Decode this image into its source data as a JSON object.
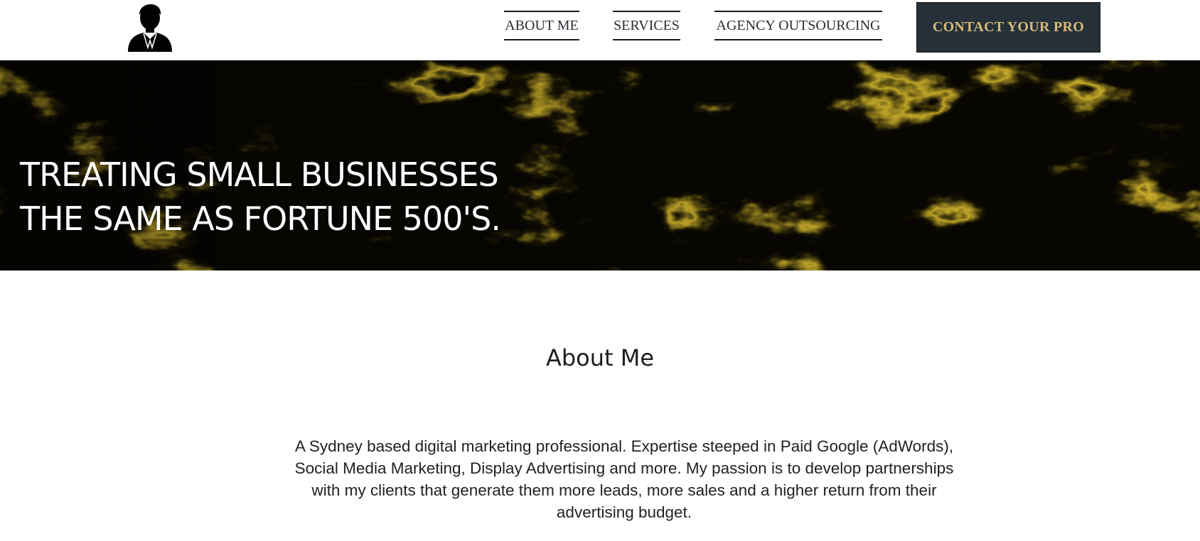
{
  "header": {
    "logo_icon": "businessman-silhouette-icon",
    "nav": [
      {
        "label": "ABOUT ME"
      },
      {
        "label": "SERVICES"
      },
      {
        "label": "AGENCY OUTSOURCING"
      }
    ],
    "contact_label": "CONTACT YOUR PRO"
  },
  "hero": {
    "line1": "TREATING SMALL BUSINESSES",
    "line2": "THE SAME AS FORTUNE 500'S.",
    "background": "black-gold-marble-texture"
  },
  "about": {
    "heading": "About Me",
    "body": "A Sydney based digital marketing professional. Expertise steeped in Paid Google (AdWords), Social Media Marketing, Display Advertising and more. My passion is to develop partnerships with my clients that generate them more leads, more sales and a higher return from their advertising budget."
  },
  "colors": {
    "accent_gold": "#d4ba7a",
    "button_dark": "#263038",
    "text_dark": "#222222"
  }
}
